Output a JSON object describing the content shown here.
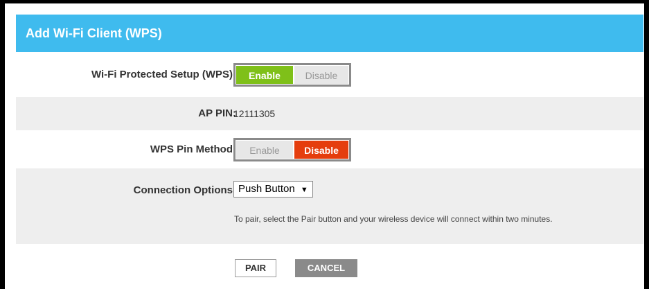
{
  "header": {
    "title": "Add Wi-Fi Client (WPS)"
  },
  "wps": {
    "label": "Wi-Fi Protected Setup (WPS):",
    "enable_label": "Enable",
    "disable_label": "Disable",
    "selected": "Enable"
  },
  "ap_pin": {
    "label": "AP PIN:",
    "value": "12111305"
  },
  "pin_method": {
    "label": "WPS Pin Method:",
    "enable_label": "Enable",
    "disable_label": "Disable",
    "selected": "Disable"
  },
  "connection": {
    "label": "Connection Options:",
    "selected_value": "Push Button",
    "hint": "To pair, select the Pair button and your wireless device will connect within two minutes."
  },
  "actions": {
    "pair_label": "PAIR",
    "cancel_label": "CANCEL"
  },
  "colors": {
    "header": "#3fbbee",
    "enable_on": "#7fc019",
    "disable_on": "#e53d0d",
    "row_alt": "#eeeeee"
  }
}
